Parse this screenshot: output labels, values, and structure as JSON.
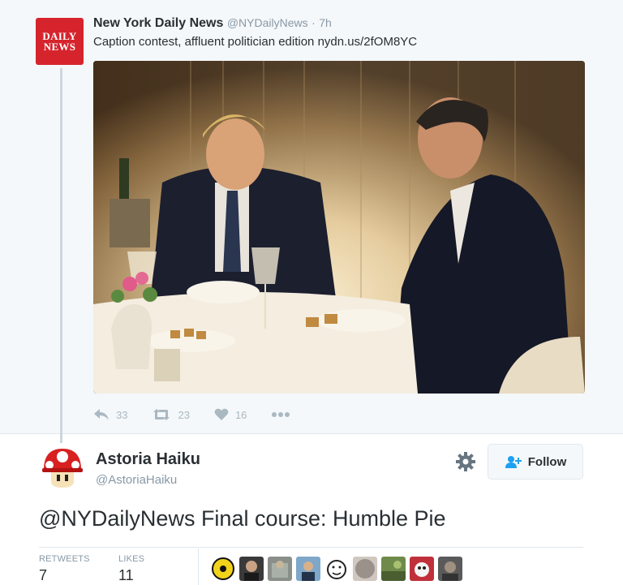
{
  "quoted_tweet": {
    "logo_line1": "DAILY",
    "logo_line2": "NEWS",
    "name": "New York Daily News",
    "handle": "@NYDailyNews",
    "separator": "·",
    "time": "7h",
    "text": "Caption contest, affluent politician edition nydn.us/2fOM8YC",
    "actions": {
      "reply_count": "33",
      "retweet_count": "23",
      "like_count": "16"
    }
  },
  "tweet": {
    "author_name": "Astoria Haiku",
    "author_handle": "@AstoriaHaiku",
    "follow_label": "Follow",
    "text": "@NYDailyNews Final course: Humble Pie",
    "stats": {
      "retweets_label": "RETWEETS",
      "retweets_value": "7",
      "likes_label": "LIKES",
      "likes_value": "11"
    }
  },
  "colors": {
    "brand_red": "#d6242d",
    "text_primary": "#292f33",
    "text_secondary": "#8899a6",
    "icon_gray": "#aab8c2",
    "border": "#e1e8ed",
    "follow_blue": "#1da1f2"
  },
  "icons": {
    "reply": "reply-icon",
    "retweet": "retweet-icon",
    "like": "heart-icon",
    "more": "more-icon",
    "settings": "gear-icon",
    "follow": "add-user-icon"
  }
}
